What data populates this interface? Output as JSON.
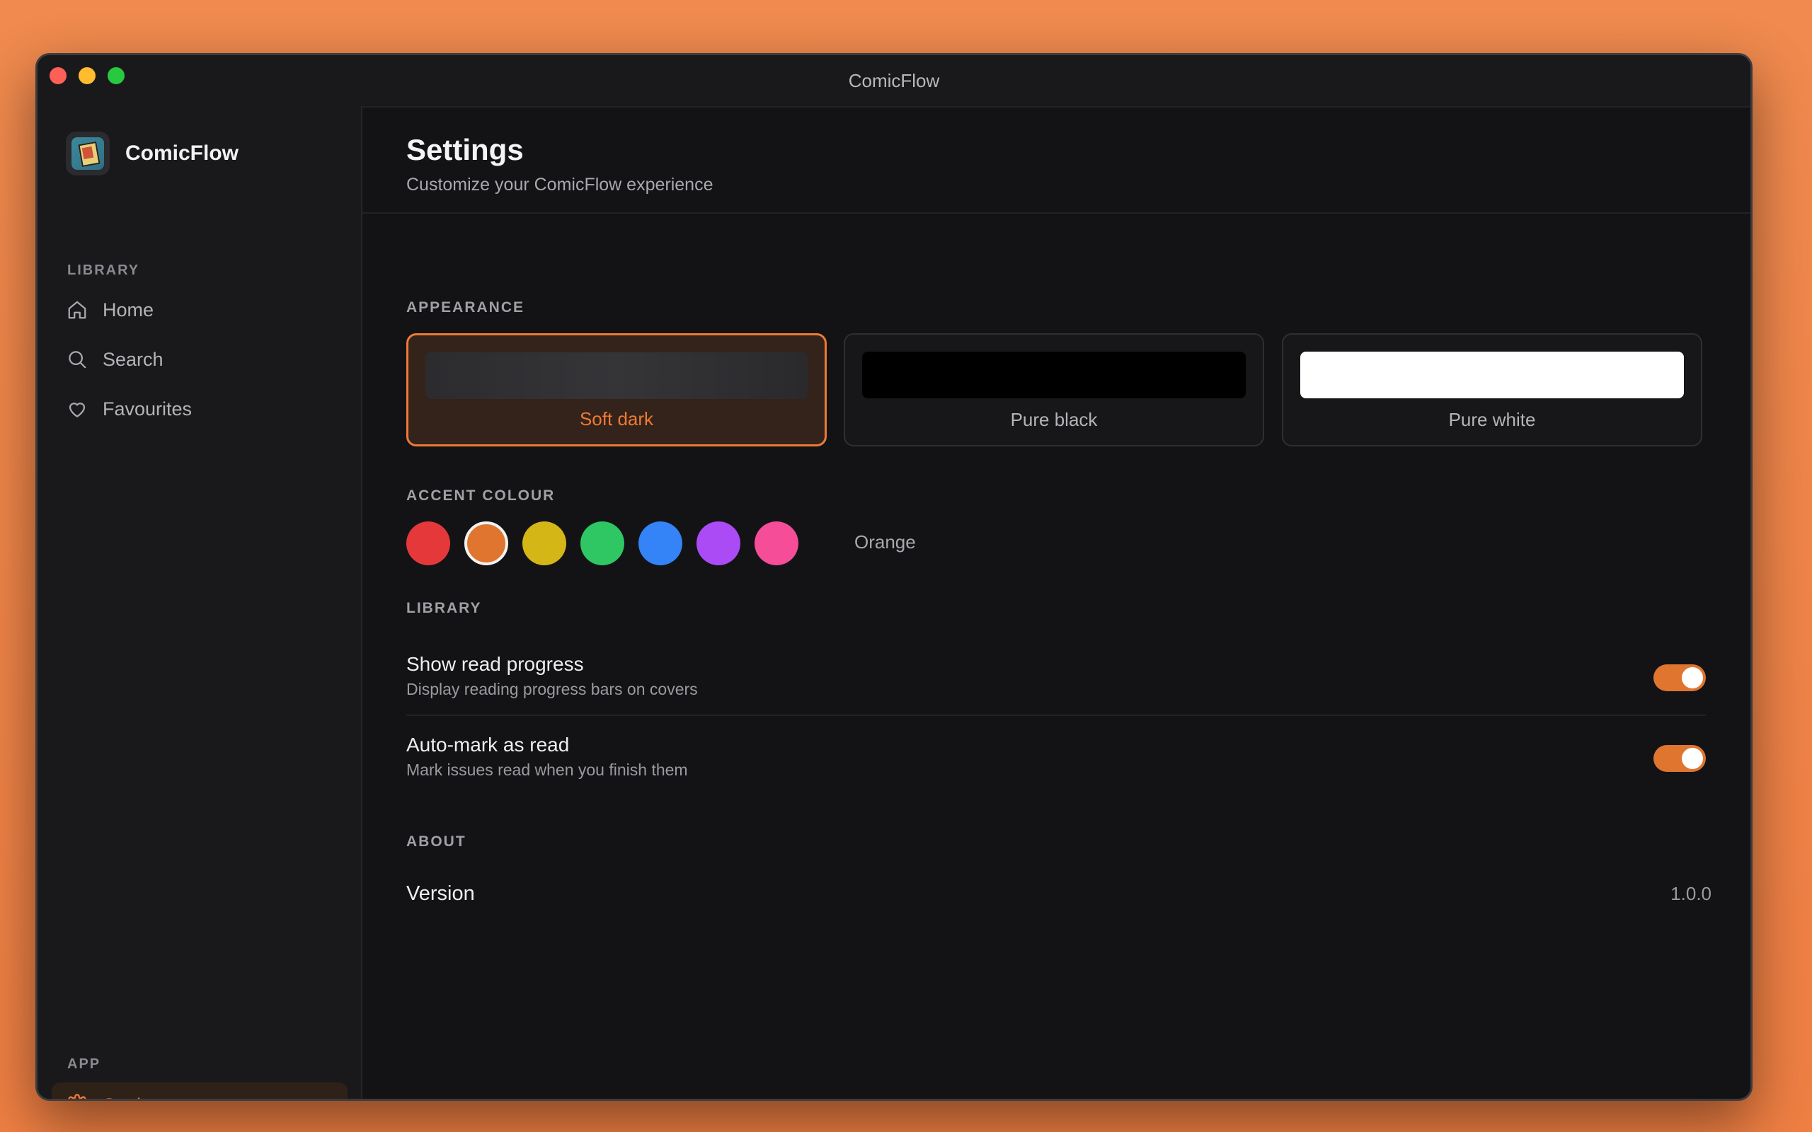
{
  "window": {
    "title": "ComicFlow"
  },
  "sidebar": {
    "app_name": "ComicFlow",
    "library_label": "LIBRARY",
    "items": [
      {
        "label": "Home",
        "icon": "home-icon"
      },
      {
        "label": "Search",
        "icon": "search-icon"
      },
      {
        "label": "Favourites",
        "icon": "heart-icon"
      }
    ],
    "app_label": "APP",
    "settings_item": {
      "label": "Settings",
      "icon": "gear-icon",
      "active": true
    }
  },
  "header": {
    "title": "Settings",
    "subtitle": "Customize your ComicFlow experience"
  },
  "appearance": {
    "label": "APPEARANCE",
    "themes": [
      {
        "label": "Soft dark",
        "selected": true,
        "swatch": "#2a2a2d"
      },
      {
        "label": "Pure black",
        "selected": false,
        "swatch": "#000000"
      },
      {
        "label": "Pure white",
        "selected": false,
        "swatch": "#ffffff"
      }
    ]
  },
  "accent": {
    "label": "ACCENT COLOUR",
    "selected_name": "Orange",
    "colors": [
      {
        "name": "red",
        "hex": "#e5383b",
        "selected": false
      },
      {
        "name": "orange",
        "hex": "#e0752f",
        "selected": true
      },
      {
        "name": "yellow",
        "hex": "#d4b616",
        "selected": false
      },
      {
        "name": "green",
        "hex": "#2fc763",
        "selected": false
      },
      {
        "name": "blue",
        "hex": "#3483f7",
        "selected": false
      },
      {
        "name": "purple",
        "hex": "#ab4bf5",
        "selected": false
      },
      {
        "name": "pink",
        "hex": "#f54d97",
        "selected": false
      }
    ]
  },
  "library": {
    "label": "LIBRARY",
    "settings": [
      {
        "title": "Show read progress",
        "description": "Display reading progress bars on covers",
        "enabled": true
      },
      {
        "title": "Auto-mark as read",
        "description": "Mark issues read when you finish them",
        "enabled": true
      }
    ]
  },
  "about": {
    "label": "ABOUT",
    "version_label": "Version",
    "version_value": "1.0.0"
  }
}
